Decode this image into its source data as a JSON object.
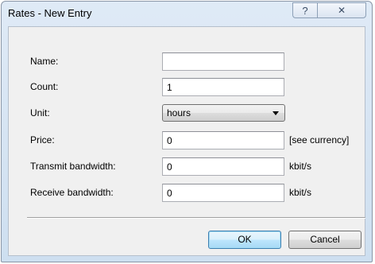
{
  "window": {
    "title": "Rates - New Entry",
    "help_icon": "?",
    "close_icon": "✕"
  },
  "form": {
    "name": {
      "label": "Name:",
      "value": ""
    },
    "count": {
      "label": "Count:",
      "value": "1"
    },
    "unit": {
      "label": "Unit:",
      "selected": "hours"
    },
    "price": {
      "label": "Price:",
      "value": "0",
      "suffix": "[see currency]"
    },
    "transmit_bandwidth": {
      "label": "Transmit bandwidth:",
      "value": "0",
      "suffix": "kbit/s"
    },
    "receive_bandwidth": {
      "label": "Receive bandwidth:",
      "value": "0",
      "suffix": "kbit/s"
    }
  },
  "buttons": {
    "ok_label": "OK",
    "cancel_label": "Cancel"
  }
}
